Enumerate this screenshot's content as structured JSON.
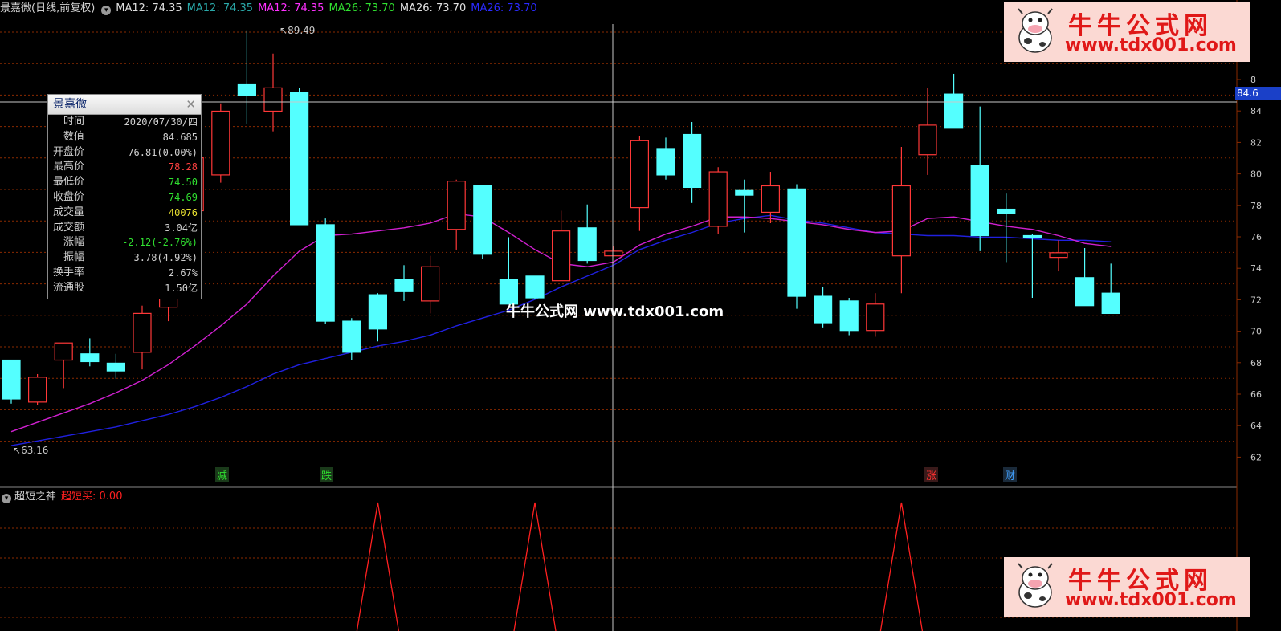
{
  "header": {
    "stock_title": "景嘉微(日线,前复权)",
    "indicators": [
      {
        "text": "MA12: 74.35",
        "color": "#e0e0e0"
      },
      {
        "text": "MA12: 74.35",
        "color": "#2aa8a8"
      },
      {
        "text": "MA12: 74.35",
        "color": "#ff30ff"
      },
      {
        "text": "MA26: 73.70",
        "color": "#30e030"
      },
      {
        "text": "MA26: 73.70",
        "color": "#e0e0e0"
      },
      {
        "text": "MA26: 73.70",
        "color": "#2a2aff"
      }
    ]
  },
  "subchart": {
    "name": "超短之神",
    "signal_label": "超短买: 0.00",
    "signal_color": "#ff2020"
  },
  "info_panel": {
    "title": "景嘉微",
    "close_icon": "close-icon",
    "rows": [
      {
        "label": "时间",
        "value": "2020/07/30/四",
        "indent": true,
        "color": "#d0d0d0"
      },
      {
        "label": "数值",
        "value": "84.685",
        "indent": true,
        "color": "#d0d0d0"
      },
      {
        "label": "开盘价",
        "value": "76.81(0.00%)",
        "indent": false,
        "color": "#d0d0d0"
      },
      {
        "label": "最高价",
        "value": "78.28",
        "indent": false,
        "color": "#ff4040"
      },
      {
        "label": "最低价",
        "value": "74.50",
        "indent": false,
        "color": "#30e030"
      },
      {
        "label": "收盘价",
        "value": "74.69",
        "indent": false,
        "color": "#30e030"
      },
      {
        "label": "成交量",
        "value": "40076",
        "indent": false,
        "color": "#e8e030"
      },
      {
        "label": "成交额",
        "value": "3.04亿",
        "indent": false,
        "color": "#d0d0d0"
      },
      {
        "label": "涨幅",
        "value": "-2.12(-2.76%)",
        "indent": true,
        "color": "#30e030"
      },
      {
        "label": "振幅",
        "value": "3.78(4.92%)",
        "indent": true,
        "color": "#d0d0d0"
      },
      {
        "label": "换手率",
        "value": "2.67%",
        "indent": false,
        "color": "#d0d0d0"
      },
      {
        "label": "流通股",
        "value": "1.50亿",
        "indent": false,
        "color": "#d0d0d0"
      }
    ]
  },
  "annotations": {
    "high_label": "89.49",
    "low_label": "63.16",
    "crosshair_value": "84.6"
  },
  "markers": [
    {
      "text": "减",
      "color": "#30e030",
      "bg": "#1a3a1a"
    },
    {
      "text": "跌",
      "color": "#30e030",
      "bg": "#1a3a1a"
    },
    {
      "text": "涨",
      "color": "#ff3030",
      "bg": "#3a1a1a"
    },
    {
      "text": "财",
      "color": "#40a0ff",
      "bg": "#1a2a3a"
    }
  ],
  "right_axis": [
    "8",
    "84",
    "82",
    "80",
    "78",
    "76",
    "74",
    "72",
    "70",
    "68",
    "66",
    "64",
    "62"
  ],
  "watermark": {
    "brand": "牛牛公式网",
    "url": "www.tdx001.com",
    "center_text": "牛牛公式网 www.tdx001.com"
  },
  "colors": {
    "up": "#ff3838",
    "down": "#54ffff",
    "ma12": "#d020d0",
    "ma26": "#2020e0",
    "grid": "#8a2a00",
    "signal": "#ff2020"
  },
  "chart_data": {
    "type": "candlestick",
    "title": "景嘉微(日线,前复权)",
    "ylim": [
      61,
      90
    ],
    "candles": [
      {
        "o": 68.3,
        "h": 68.3,
        "l": 65.5,
        "c": 65.8
      },
      {
        "o": 65.6,
        "h": 67.4,
        "l": 65.4,
        "c": 67.2
      },
      {
        "o": 68.3,
        "h": 68.9,
        "l": 66.5,
        "c": 69.4
      },
      {
        "o": 68.7,
        "h": 69.7,
        "l": 67.9,
        "c": 68.2
      },
      {
        "o": 68.1,
        "h": 68.7,
        "l": 67.1,
        "c": 67.6
      },
      {
        "o": 68.8,
        "h": 71.8,
        "l": 67.7,
        "c": 71.3
      },
      {
        "o": 71.7,
        "h": 75.6,
        "l": 70.8,
        "c": 75.3
      },
      {
        "o": 77.9,
        "h": 80.4,
        "l": 77.3,
        "c": 81.3
      },
      {
        "o": 80.2,
        "h": 84.8,
        "l": 79.7,
        "c": 84.3
      },
      {
        "o": 86.0,
        "h": 89.5,
        "l": 83.5,
        "c": 85.3
      },
      {
        "o": 84.3,
        "h": 88.0,
        "l": 83.0,
        "c": 85.8
      },
      {
        "o": 85.5,
        "h": 85.8,
        "l": 77.0,
        "c": 77.0
      },
      {
        "o": 77.0,
        "h": 77.4,
        "l": 70.6,
        "c": 70.8
      },
      {
        "o": 70.8,
        "h": 71.0,
        "l": 68.3,
        "c": 68.8
      },
      {
        "o": 72.5,
        "h": 72.6,
        "l": 69.5,
        "c": 70.3
      },
      {
        "o": 73.5,
        "h": 74.4,
        "l": 72.1,
        "c": 72.7
      },
      {
        "o": 72.1,
        "h": 75.0,
        "l": 71.3,
        "c": 74.3
      },
      {
        "o": 76.7,
        "h": 79.9,
        "l": 75.4,
        "c": 79.8
      },
      {
        "o": 79.5,
        "h": 79.5,
        "l": 74.8,
        "c": 75.1
      },
      {
        "o": 73.5,
        "h": 76.2,
        "l": 71.9,
        "c": 71.9
      },
      {
        "o": 73.7,
        "h": 73.7,
        "l": 72.2,
        "c": 72.3
      },
      {
        "o": 73.4,
        "h": 77.9,
        "l": 73.4,
        "c": 76.6
      },
      {
        "o": 76.8,
        "h": 78.3,
        "l": 74.5,
        "c": 74.7
      },
      {
        "o": 75.0,
        "h": 75.6,
        "l": 75.2,
        "c": 75.3
      },
      {
        "o": 78.1,
        "h": 82.7,
        "l": 76.6,
        "c": 82.4
      },
      {
        "o": 81.9,
        "h": 82.6,
        "l": 79.9,
        "c": 80.2
      },
      {
        "o": 82.8,
        "h": 83.6,
        "l": 78.4,
        "c": 79.4
      },
      {
        "o": 76.9,
        "h": 80.7,
        "l": 76.4,
        "c": 80.4
      },
      {
        "o": 79.2,
        "h": 79.9,
        "l": 76.5,
        "c": 78.9
      },
      {
        "o": 77.8,
        "h": 80.4,
        "l": 77.1,
        "c": 79.5
      },
      {
        "o": 79.3,
        "h": 79.6,
        "l": 71.6,
        "c": 72.4
      },
      {
        "o": 72.4,
        "h": 73.0,
        "l": 70.4,
        "c": 70.7
      },
      {
        "o": 72.1,
        "h": 72.3,
        "l": 69.9,
        "c": 70.2
      },
      {
        "o": 70.2,
        "h": 72.6,
        "l": 69.8,
        "c": 71.9
      },
      {
        "o": 75.0,
        "h": 82.0,
        "l": 72.6,
        "c": 79.5
      },
      {
        "o": 81.5,
        "h": 85.8,
        "l": 80.2,
        "c": 83.4
      },
      {
        "o": 85.4,
        "h": 86.7,
        "l": 83.2,
        "c": 83.2
      },
      {
        "o": 80.8,
        "h": 84.6,
        "l": 75.3,
        "c": 76.3
      },
      {
        "o": 78.0,
        "h": 79.0,
        "l": 74.6,
        "c": 77.7
      },
      {
        "o": 76.3,
        "h": 76.4,
        "l": 72.3,
        "c": 76.2
      },
      {
        "o": 74.9,
        "h": 76.0,
        "l": 74.0,
        "c": 75.2
      },
      {
        "o": 73.6,
        "h": 75.5,
        "l": 72.3,
        "c": 71.8
      },
      {
        "o": 72.6,
        "h": 74.5,
        "l": 72.4,
        "c": 71.3
      }
    ],
    "ma12": [
      63.7,
      64.3,
      64.9,
      65.5,
      66.2,
      67.0,
      68.0,
      69.2,
      70.5,
      71.9,
      73.7,
      75.3,
      76.3,
      76.4,
      76.6,
      76.8,
      77.1,
      77.7,
      77.5,
      76.5,
      75.4,
      74.5,
      74.3,
      74.6,
      75.7,
      76.4,
      76.9,
      77.5,
      77.5,
      77.4,
      77.2,
      77.0,
      76.7,
      76.5,
      76.6,
      77.4,
      77.5,
      77.2,
      76.9,
      76.7,
      76.3,
      75.8,
      75.6
    ],
    "ma26": [
      62.8,
      63.1,
      63.4,
      63.7,
      64.0,
      64.4,
      64.8,
      65.3,
      65.9,
      66.6,
      67.4,
      68.0,
      68.4,
      68.8,
      69.2,
      69.5,
      69.9,
      70.5,
      71.0,
      71.5,
      72.2,
      73.0,
      73.7,
      74.4,
      75.4,
      76.0,
      76.5,
      77.1,
      77.4,
      77.6,
      77.3,
      77.1,
      76.8,
      76.5,
      76.4,
      76.3,
      76.3,
      76.2,
      76.2,
      76.1,
      76.0,
      76.0,
      75.9
    ],
    "signal": [
      0,
      0,
      0,
      0,
      0,
      0,
      0,
      0,
      0,
      0,
      0,
      0,
      0,
      0,
      1,
      0,
      0,
      0,
      0,
      0,
      1,
      0,
      0,
      0,
      0,
      0,
      0,
      0,
      0,
      0,
      0,
      0,
      0,
      0,
      1,
      0,
      0,
      0,
      0,
      0,
      0,
      0,
      0
    ]
  }
}
